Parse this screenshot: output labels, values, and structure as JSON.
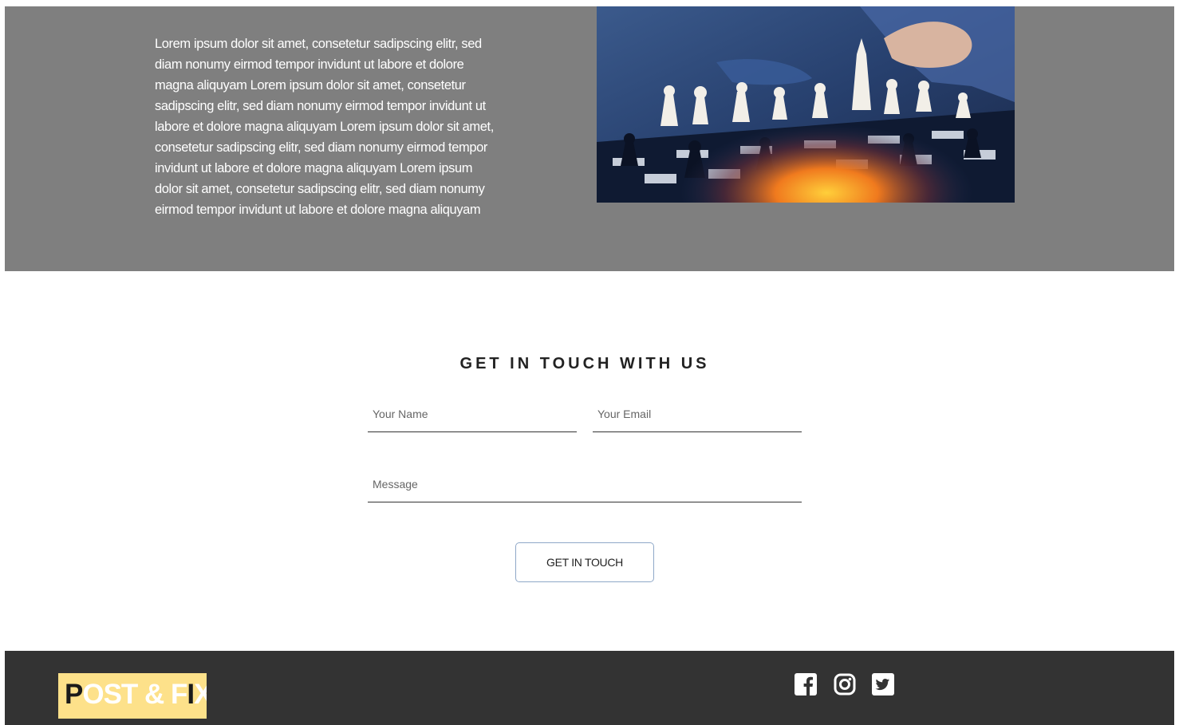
{
  "hero": {
    "heading_partial": "",
    "body": "Lorem ipsum dolor sit amet, consetetur sadipscing elitr, sed diam nonumy eirmod tempor invidunt ut labore et dolore magna aliquyam Lorem ipsum dolor sit amet, consetetur sadipscing elitr, sed diam nonumy eirmod tempor invidunt ut labore et dolore magna aliquyam Lorem ipsum dolor sit amet, consetetur sadipscing elitr, sed diam nonumy eirmod tempor invidunt ut labore et dolore magna aliquyam Lorem ipsum dolor sit amet, consetetur sadipscing elitr, sed diam nonumy eirmod tempor invidunt ut labore et dolore magna aliquyam",
    "image_icon": "chess-photo"
  },
  "contact": {
    "title": "GET IN TOUCH WITH US",
    "name_placeholder": "Your Name",
    "email_placeholder": "Your Email",
    "message_placeholder": "Message",
    "submit_label": "GET IN TOUCH"
  },
  "footer": {
    "logo_part1": "P",
    "logo_part2": "OST & F",
    "logo_part3": "I",
    "logo_part4": "X",
    "social": [
      {
        "icon": "facebook-icon"
      },
      {
        "icon": "instagram-icon"
      },
      {
        "icon": "twitter-icon"
      }
    ]
  },
  "colors": {
    "hero_bg": "#7f7f7f",
    "footer_bg": "#333333",
    "logo_bg": "#fde18a",
    "button_border": "#8fa8c8"
  }
}
